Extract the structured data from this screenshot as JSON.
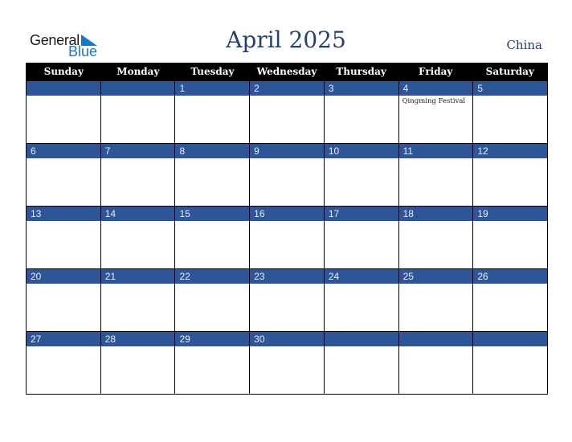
{
  "logo": {
    "line1": "General",
    "line2": "Blue",
    "icon": "triangle-flag-icon",
    "accent": "#1b78c7"
  },
  "header": {
    "title": "April 2025",
    "country": "China"
  },
  "colors": {
    "header_bg": "#000000",
    "date_bar": "#2d5597",
    "title": "#26406e"
  },
  "calendar": {
    "weekdays": [
      "Sunday",
      "Monday",
      "Tuesday",
      "Wednesday",
      "Thursday",
      "Friday",
      "Saturday"
    ],
    "weeks": [
      [
        {
          "day": "",
          "event": ""
        },
        {
          "day": "",
          "event": ""
        },
        {
          "day": "1",
          "event": ""
        },
        {
          "day": "2",
          "event": ""
        },
        {
          "day": "3",
          "event": ""
        },
        {
          "day": "4",
          "event": "Qingming Festival"
        },
        {
          "day": "5",
          "event": ""
        }
      ],
      [
        {
          "day": "6",
          "event": ""
        },
        {
          "day": "7",
          "event": ""
        },
        {
          "day": "8",
          "event": ""
        },
        {
          "day": "9",
          "event": ""
        },
        {
          "day": "10",
          "event": ""
        },
        {
          "day": "11",
          "event": ""
        },
        {
          "day": "12",
          "event": ""
        }
      ],
      [
        {
          "day": "13",
          "event": ""
        },
        {
          "day": "14",
          "event": ""
        },
        {
          "day": "15",
          "event": ""
        },
        {
          "day": "16",
          "event": ""
        },
        {
          "day": "17",
          "event": ""
        },
        {
          "day": "18",
          "event": ""
        },
        {
          "day": "19",
          "event": ""
        }
      ],
      [
        {
          "day": "20",
          "event": ""
        },
        {
          "day": "21",
          "event": ""
        },
        {
          "day": "22",
          "event": ""
        },
        {
          "day": "23",
          "event": ""
        },
        {
          "day": "24",
          "event": ""
        },
        {
          "day": "25",
          "event": ""
        },
        {
          "day": "26",
          "event": ""
        }
      ],
      [
        {
          "day": "27",
          "event": ""
        },
        {
          "day": "28",
          "event": ""
        },
        {
          "day": "29",
          "event": ""
        },
        {
          "day": "30",
          "event": ""
        },
        {
          "day": "",
          "event": ""
        },
        {
          "day": "",
          "event": ""
        },
        {
          "day": "",
          "event": ""
        }
      ]
    ]
  }
}
